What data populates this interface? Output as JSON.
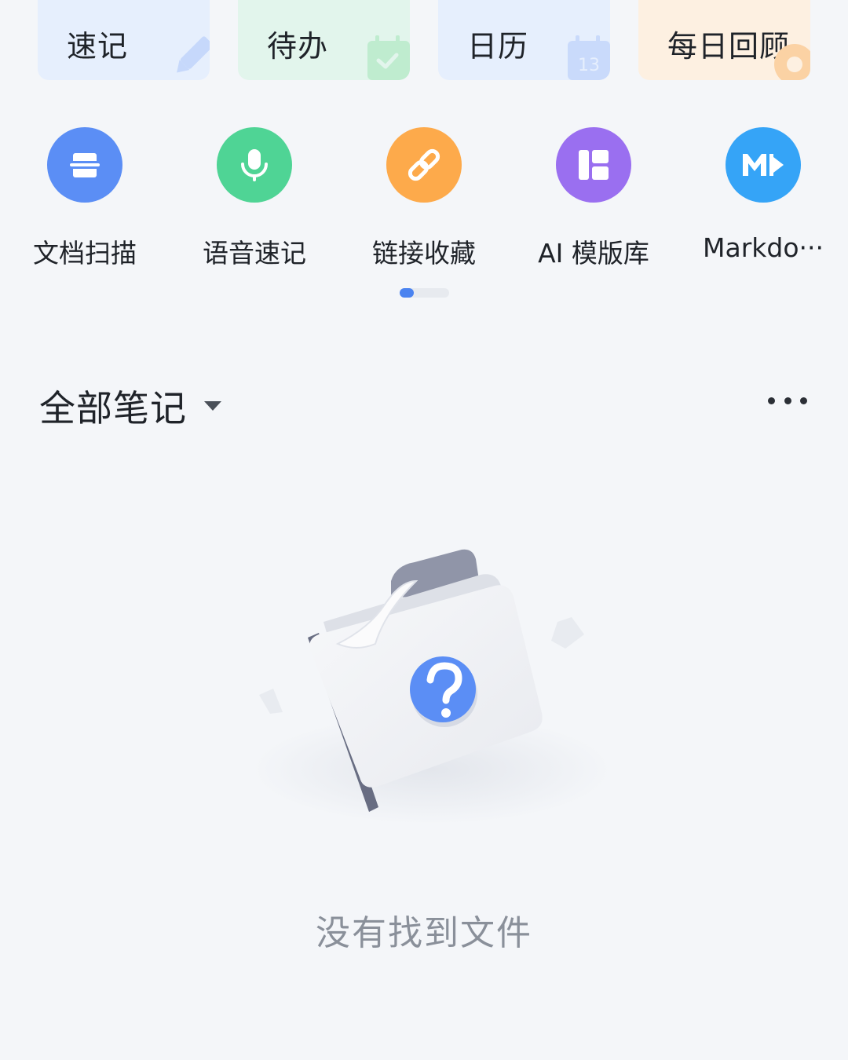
{
  "quick_cards": [
    {
      "label": "速记",
      "icon": "pencil-icon",
      "bg": "#e6effd"
    },
    {
      "label": "待办",
      "icon": "calendar-check-icon",
      "bg": "#e2f5ec"
    },
    {
      "label": "日历",
      "icon": "calendar-13-icon",
      "bg": "#e6effd",
      "calendar_day": "13"
    },
    {
      "label": "每日回顾",
      "icon": "sun-icon",
      "bg": "#fdf0e1"
    }
  ],
  "features": [
    {
      "label": "文档扫描",
      "icon": "scan-icon",
      "color": "#5b8ef5"
    },
    {
      "label": "语音速记",
      "icon": "microphone-icon",
      "color": "#4fd495"
    },
    {
      "label": "链接收藏",
      "icon": "link-icon",
      "color": "#fdaa4b"
    },
    {
      "label": "AI 模版库",
      "icon": "template-icon",
      "color": "#9a6ff0"
    },
    {
      "label": "Markdo···",
      "icon": "markdown-icon",
      "color": "#35a4f7"
    }
  ],
  "pager": {
    "pages": 2,
    "current": 1
  },
  "section": {
    "title": "全部笔记",
    "more_icon": "more-icon",
    "dropdown_icon": "caret-down-icon"
  },
  "empty": {
    "message": "没有找到文件",
    "illustration_icon": "empty-folder-question-icon"
  }
}
